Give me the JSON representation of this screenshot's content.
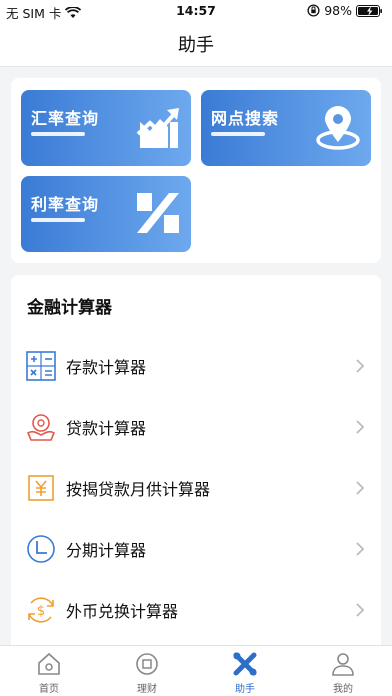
{
  "status": {
    "carrier": "无 SIM 卡",
    "time": "14:57",
    "battery": "98%"
  },
  "nav": {
    "title": "助手"
  },
  "tiles": [
    {
      "label": "汇率查询",
      "icon": "trend-chart-icon"
    },
    {
      "label": "网点搜索",
      "icon": "location-pin-icon"
    },
    {
      "label": "利率查询",
      "icon": "percent-icon"
    }
  ],
  "calculators": {
    "title": "金融计算器",
    "items": [
      {
        "label": "存款计算器",
        "icon": "calculator-icon",
        "color": "#3a7bd5"
      },
      {
        "label": "贷款计算器",
        "icon": "hand-coin-icon",
        "color": "#e2574c"
      },
      {
        "label": "按揭贷款月供计算器",
        "icon": "yen-note-icon",
        "color": "#f0a030"
      },
      {
        "label": "分期计算器",
        "icon": "clock-icon",
        "color": "#3a7bd5"
      },
      {
        "label": "外币兑换计算器",
        "icon": "currency-exchange-icon",
        "color": "#f0a030"
      }
    ]
  },
  "tabbar": {
    "items": [
      {
        "label": "首页",
        "icon": "home-icon"
      },
      {
        "label": "理财",
        "icon": "wealth-icon"
      },
      {
        "label": "助手",
        "icon": "assistant-icon",
        "active": true
      },
      {
        "label": "我的",
        "icon": "profile-icon"
      }
    ]
  },
  "colors": {
    "accent": "#2d6ec9",
    "tile_start": "#3a7bd5",
    "tile_end": "#6ea9ee"
  }
}
